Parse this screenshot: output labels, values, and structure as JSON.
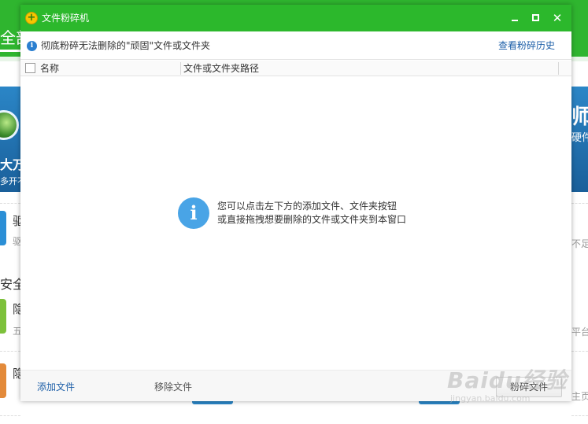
{
  "background": {
    "tab_partial": "全部",
    "banner_left_title": "大万",
    "banner_left_sub": "多开不",
    "banner_right_title": "师",
    "banner_right_sub": "硬件",
    "row1_title": "驱",
    "row1_sub": "驱",
    "row1_right": "不足",
    "section_title": "安全",
    "row2_title": "隐",
    "row2_sub": "五",
    "row2_right": "平台",
    "row3_title": "隐",
    "row3_right": "主页",
    "colors": {
      "header_green": "#2fb52f",
      "banner_blue": "#2b86c7"
    }
  },
  "dialog": {
    "title": "文件粉碎机",
    "icon": "plus-shield-icon",
    "window_controls": {
      "minimize": "minimize-icon",
      "maximize": "maximize-icon",
      "close": "✕"
    },
    "info_text": "彻底粉碎无法删除的\"顽固\"文件或文件夹",
    "history_link": "查看粉碎历史",
    "columns": {
      "name": "名称",
      "path": "文件或文件夹路径"
    },
    "empty_hint": {
      "line1": "您可以点击左下方的添加文件、文件夹按钮",
      "line2": "或直接拖拽想要删除的文件或文件夹到本窗口"
    },
    "footer": {
      "add_file": "添加文件",
      "remove_file": "移除文件",
      "shred_button": "粉碎文件"
    },
    "colors": {
      "titlebar_green": "#2cb82c",
      "link_blue": "#1d5fa8",
      "info_blue": "#49a4e6"
    }
  },
  "watermark": {
    "main": "Baidu经验",
    "sub": "jingyan.baidu.com"
  }
}
